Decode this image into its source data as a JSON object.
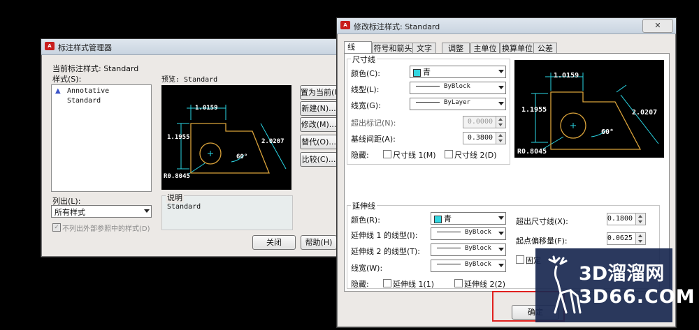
{
  "manager": {
    "title": "标注样式管理器",
    "current_style_label": "当前标注样式: Standard",
    "styles_label": "样式(S):",
    "styles": [
      "Annotative",
      "Standard"
    ],
    "preview_label": "预览: Standard",
    "list_label": "列出(L):",
    "list_value": "所有样式",
    "exclude_xref": "不列出外部参照中的样式(D)",
    "desc_label": "说明",
    "desc_value": "Standard",
    "buttons": {
      "set_current": "置为当前(U)",
      "new": "新建(N)...",
      "modify": "修改(M)...",
      "override": "替代(O)...",
      "compare": "比较(C)...",
      "close": "关闭",
      "help": "帮助(H)"
    }
  },
  "modify": {
    "title": "修改标注样式: Standard",
    "tabs": [
      "线",
      "符号和箭头",
      "文字",
      "调整",
      "主单位",
      "换算单位",
      "公差"
    ],
    "dim_group": "尺寸线",
    "dim_color_label": "颜色(C):",
    "dim_color_value": "青",
    "dim_linetype_label": "线型(L):",
    "dim_linetype_value": "ByBlock",
    "dim_lineweight_label": "线宽(G):",
    "dim_lineweight_value": "ByLayer",
    "extend_ticks_label": "超出标记(N):",
    "extend_ticks_value": "0.0000",
    "baseline_label": "基线间距(A):",
    "baseline_value": "0.3800",
    "suppress_label": "隐藏:",
    "dim_line1": "尺寸线 1(M)",
    "dim_line2": "尺寸线 2(D)",
    "ext_group": "延伸线",
    "ext_color_label": "颜色(R):",
    "ext_color_value": "青",
    "ext1_linetype_label": "延伸线 1 的线型(I):",
    "ext1_linetype_value": "ByBlock",
    "ext2_linetype_label": "延伸线 2 的线型(T):",
    "ext2_linetype_value": "ByBlock",
    "ext_lineweight_label": "线宽(W):",
    "ext_lineweight_value": "ByBlock",
    "ext_beyond_label": "超出尺寸线(X):",
    "ext_beyond_value": "0.1800",
    "offset_label": "起点偏移量(F):",
    "offset_value": "0.0625",
    "fixed_label": "固定",
    "ext_line1": "延伸线 1(1)",
    "ext_line2": "延伸线 2(2)",
    "ok": "确定"
  },
  "preview_dims": {
    "top": "1.0159",
    "left": "1.1955",
    "right": "2.0207",
    "angle": "60°",
    "radius": "R0.8045"
  },
  "watermark": {
    "line1": "3D溜溜网",
    "line2": "3D66.COM"
  },
  "colors": {
    "preview_line": "#d9a23a",
    "dim_cyan": "#2ad7e6",
    "highlight": "#e0201e"
  }
}
